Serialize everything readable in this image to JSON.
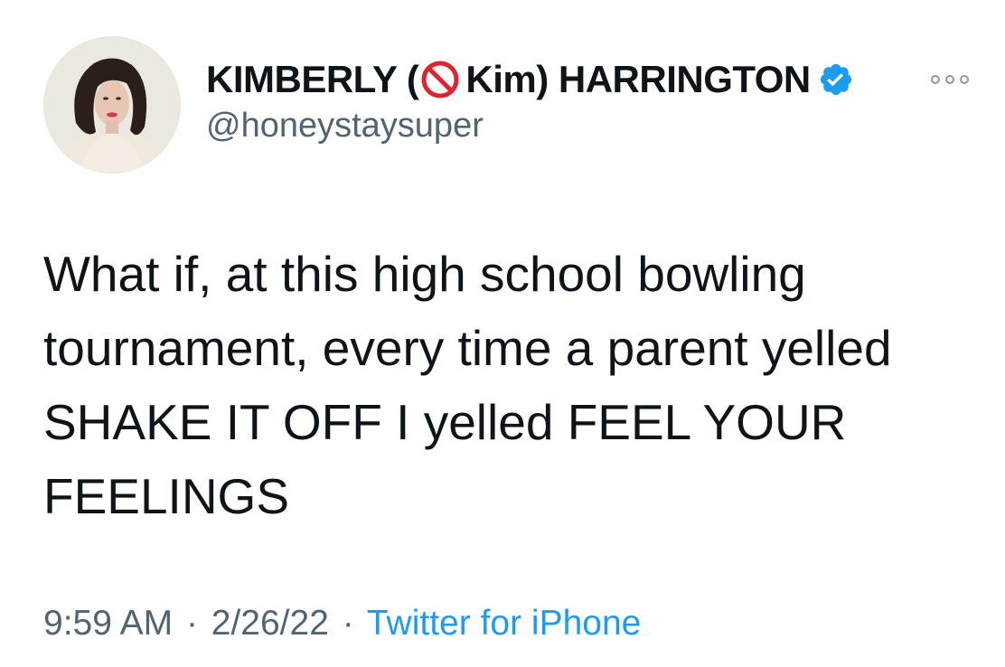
{
  "author": {
    "name_before": "KIMBERLY (",
    "name_after": "Kim) HARRINGTON",
    "name_icon": "no-entry-icon",
    "verified_icon": "verified-badge-icon",
    "handle": "@honeystaysuper",
    "avatar": "profile-photo"
  },
  "tweet": {
    "text": "What if, at this high school bowling tournament, every time a parent yelled SHAKE IT OFF I yelled FEEL YOUR FEELINGS"
  },
  "meta": {
    "time": "9:59 AM",
    "date": "2/26/22",
    "separator": "·",
    "source": "Twitter for iPhone"
  },
  "menu": {
    "icon": "more-options-icon"
  },
  "colors": {
    "text": "#0f1419",
    "secondary": "#536471",
    "accent": "#1d9bf0",
    "no_entry_red": "#e0242f"
  }
}
